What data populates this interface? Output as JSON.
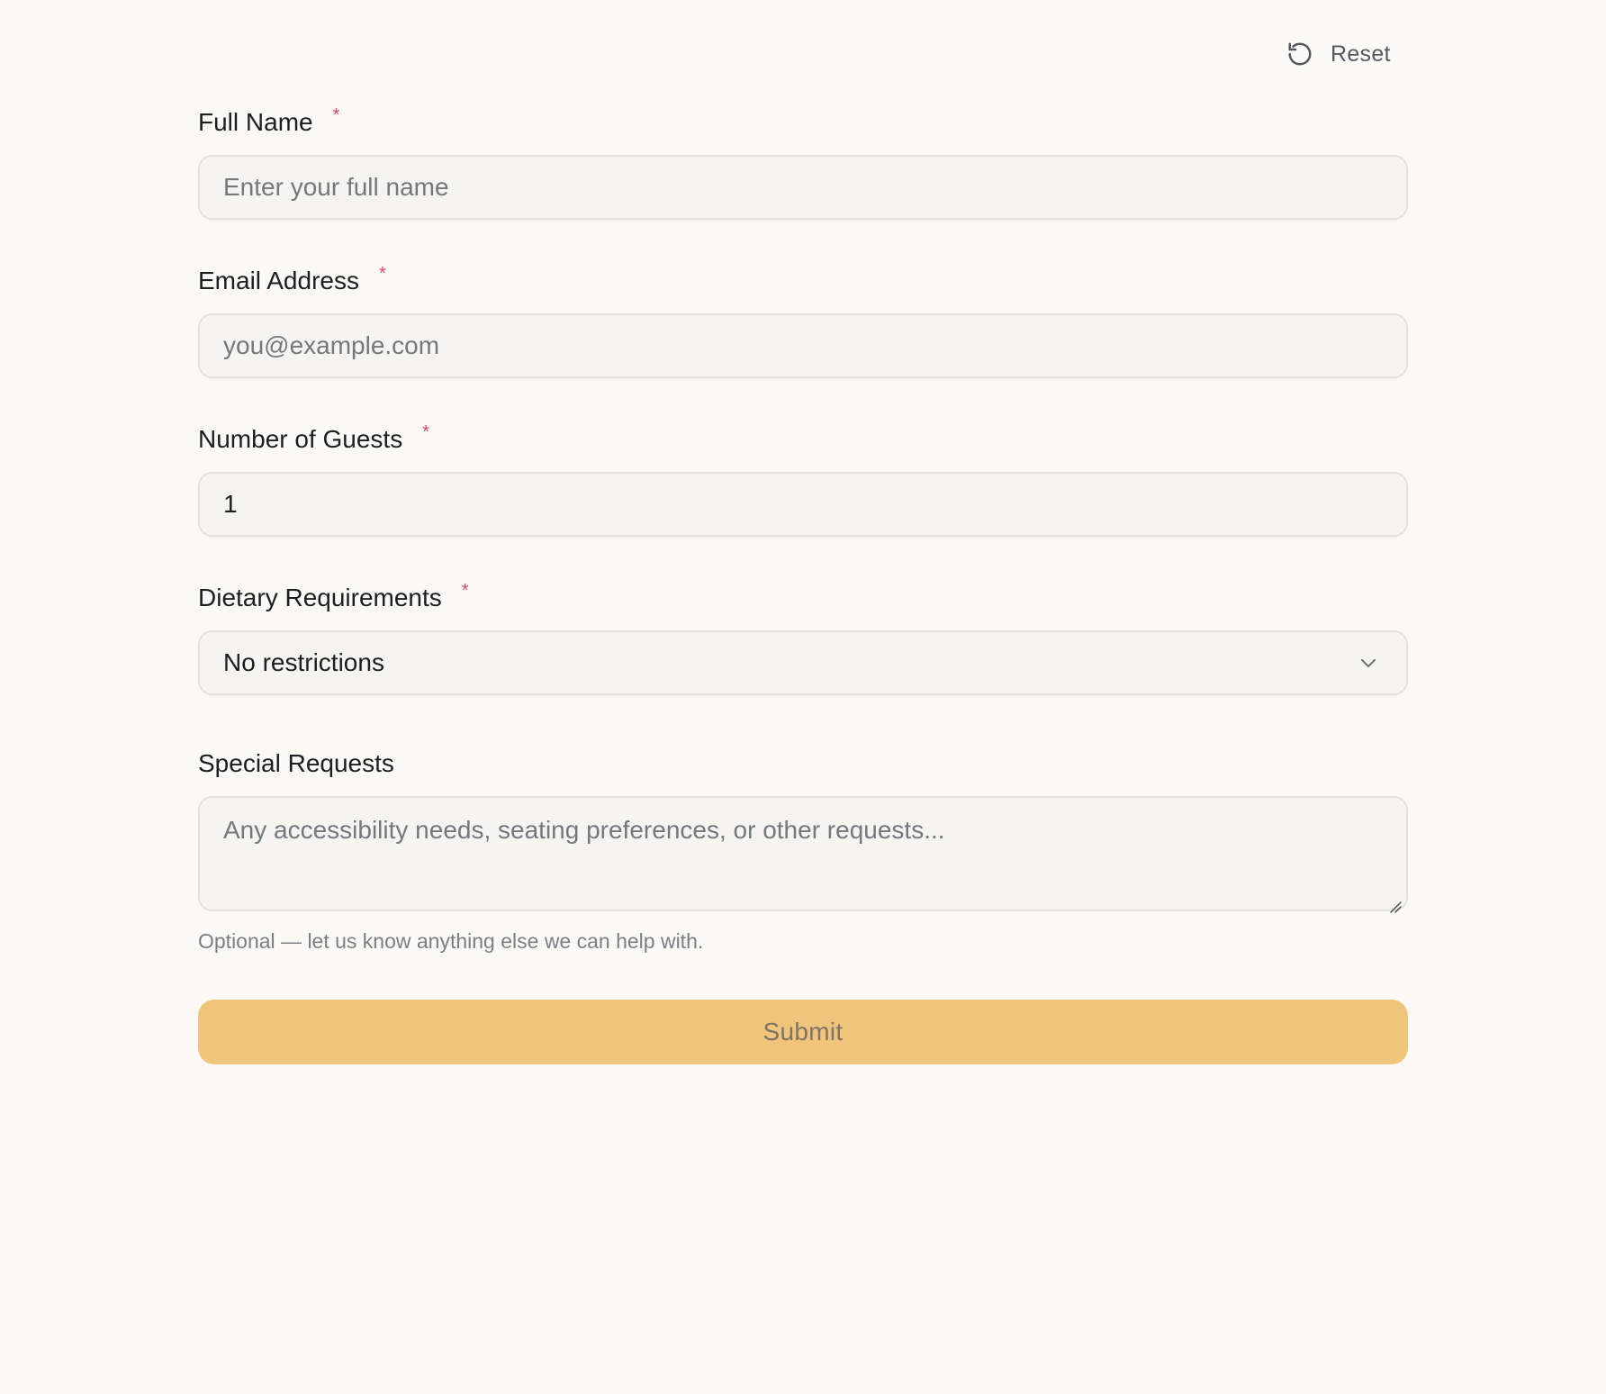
{
  "header": {
    "reset_label": "Reset",
    "reset_icon": "rotate-ccw-icon"
  },
  "form": {
    "full_name": {
      "label": "Full Name",
      "required_marker": "*",
      "placeholder": "Enter your full name",
      "value": ""
    },
    "email": {
      "label": "Email Address",
      "required_marker": "*",
      "placeholder": "you@example.com",
      "value": ""
    },
    "guests": {
      "label": "Number of Guests",
      "required_marker": "*",
      "value": "1"
    },
    "dietary": {
      "label": "Dietary Requirements",
      "required_marker": "*",
      "selected": "No restrictions",
      "icon": "chevron-down-icon"
    },
    "special_requests": {
      "label": "Special Requests",
      "placeholder": "Any accessibility needs, seating preferences, or other requests...",
      "hint": "Optional — let us know anything else we can help with."
    },
    "submit_label": "Submit"
  },
  "colors": {
    "background": "#faf9f6",
    "field_background": "#f5f4f1",
    "required": "#d94a5e",
    "submit_background": "#f1c47b",
    "submit_text": "#7d7468"
  }
}
